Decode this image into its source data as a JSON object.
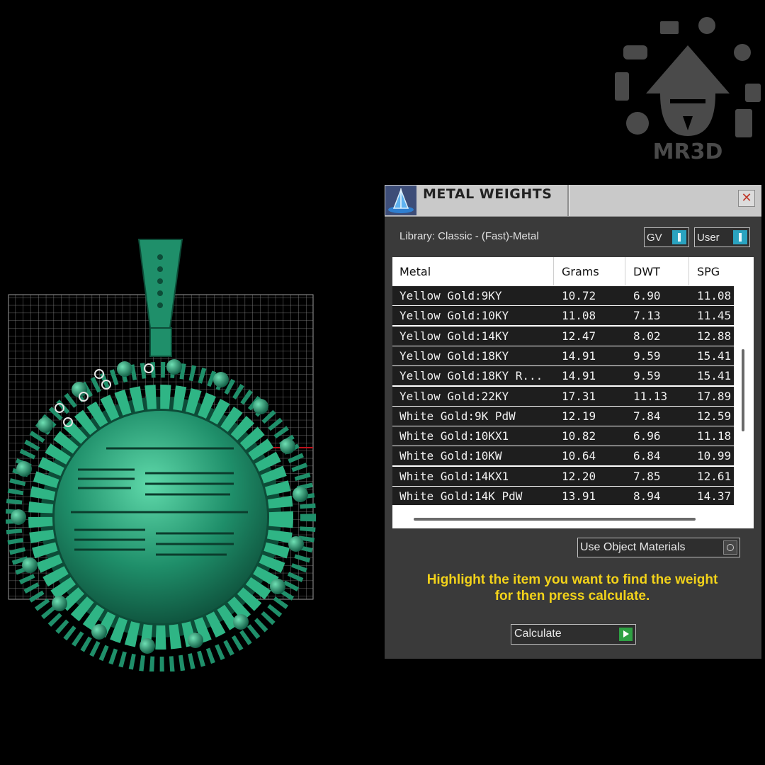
{
  "logo": {
    "text": "MR3D"
  },
  "dialog": {
    "title": "METAL WEIGHTS",
    "close_glyph": "✕",
    "library_label": "Library: Classic - (Fast)-Metal",
    "toggle_gv": "GV",
    "toggle_user": "User",
    "table": {
      "headers": [
        "Metal",
        "Grams",
        "DWT",
        "SPG"
      ],
      "rows": [
        [
          "Yellow Gold:9KY",
          "10.72",
          "6.90",
          "11.08"
        ],
        [
          "Yellow Gold:10KY",
          "11.08",
          "7.13",
          "11.45"
        ],
        [
          "Yellow Gold:14KY",
          "12.47",
          "8.02",
          "12.88"
        ],
        [
          "Yellow Gold:18KY",
          "14.91",
          "9.59",
          "15.41"
        ],
        [
          "Yellow Gold:18KY R...",
          "14.91",
          "9.59",
          "15.41"
        ],
        [
          "Yellow Gold:22KY",
          "17.31",
          "11.13",
          "17.89"
        ],
        [
          "White Gold:9K PdW",
          "12.19",
          "7.84",
          "12.59"
        ],
        [
          "White Gold:10KX1",
          "10.82",
          "6.96",
          "11.18"
        ],
        [
          "White Gold:10KW",
          "10.64",
          "6.84",
          "10.99"
        ],
        [
          "White Gold:14KX1",
          "12.20",
          "7.85",
          "12.61"
        ],
        [
          "White Gold:14K PdW",
          "13.91",
          "8.94",
          "14.37"
        ]
      ]
    },
    "use_object_materials": "Use Object Materials",
    "instruction_line1": "Highlight the item you want to find the weight",
    "instruction_line2": "for then press calculate.",
    "calculate_label": "Calculate"
  },
  "colors": {
    "model_green": "#1f8f6a",
    "instruction_yellow": "#f2d21a",
    "toggle_accent": "#2aa3c0",
    "play_green": "#2ea043"
  }
}
